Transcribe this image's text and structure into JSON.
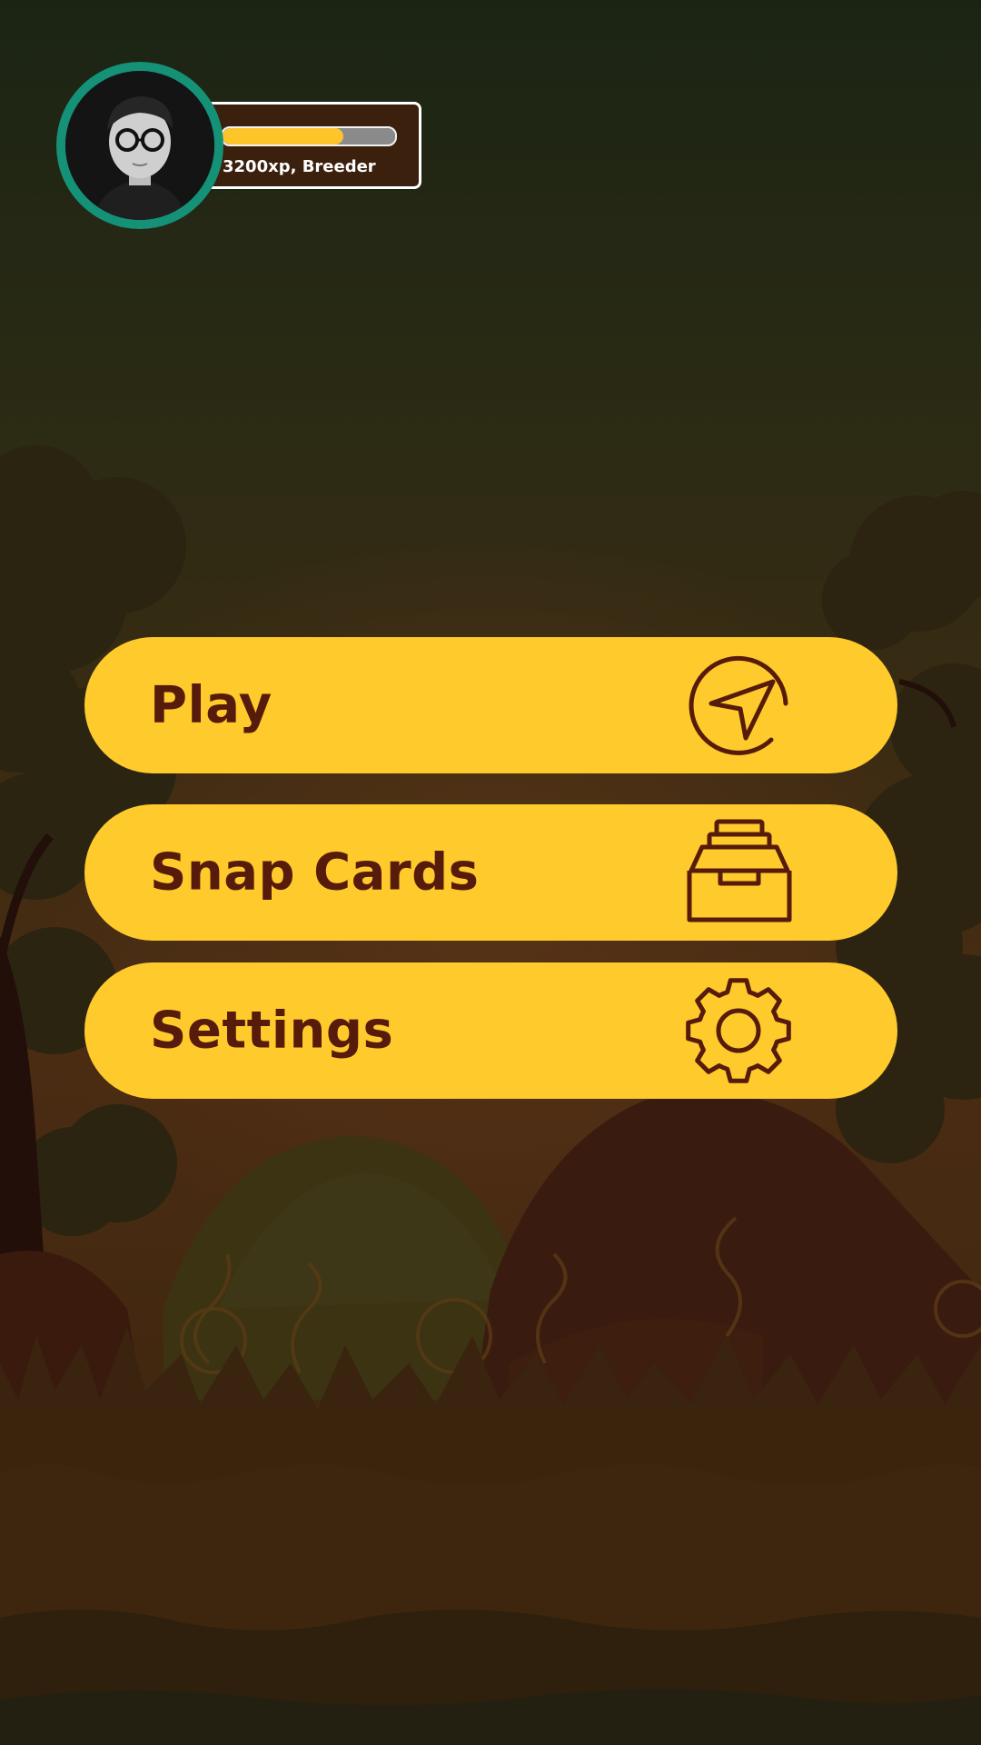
{
  "player": {
    "xp_text": "3200xp, Breeder",
    "xp_progress": 0.7
  },
  "menu": {
    "play_label": "Play",
    "snap_cards_label": "Snap Cards",
    "settings_label": "Settings"
  },
  "colors": {
    "button": "#ffca2c",
    "button_text": "#561b0b",
    "avatar_ring": "#149177",
    "xp_fill": "#fdc52a",
    "xp_panel": "#3b200e"
  },
  "icons": {
    "play": "navigation-arrow-icon",
    "snap_cards": "card-tray-icon",
    "settings": "gear-icon"
  }
}
